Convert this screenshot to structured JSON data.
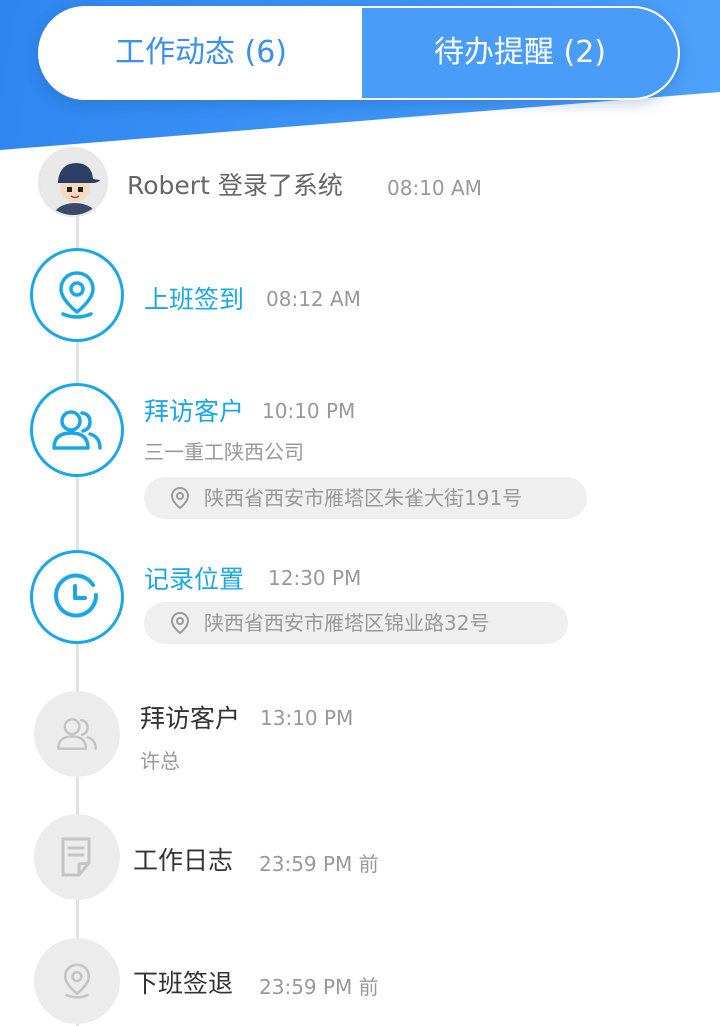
{
  "tabs": [
    {
      "label": "工作动态 (6)",
      "active": false
    },
    {
      "label": "待办提醒 (2)",
      "active": true
    }
  ],
  "timeline": {
    "login": {
      "user": "Robert",
      "action": "Robert 登录了系统",
      "time": "08:10 AM",
      "icon": "avatar"
    },
    "items": [
      {
        "title": "上班签到",
        "time": "08:12 AM",
        "icon": "location-pin-icon",
        "state": "active"
      },
      {
        "title": "拜访客户",
        "time": "10:10 PM",
        "subtitle": "三一重工陕西公司",
        "address": "陕西省西安市雁塔区朱雀大街191号",
        "icon": "users-icon",
        "state": "active"
      },
      {
        "title": "记录位置",
        "time": "12:30 PM",
        "address": "陕西省西安市雁塔区锦业路32号",
        "icon": "clock-icon",
        "state": "active"
      },
      {
        "title": "拜访客户",
        "time": "13:10 PM",
        "subtitle": "许总",
        "icon": "users-icon",
        "state": "pending"
      },
      {
        "title": "工作日志",
        "time": "23:59 PM 前",
        "icon": "document-icon",
        "state": "pending"
      },
      {
        "title": "下班签退",
        "time": "23:59 PM 前",
        "icon": "location-pin-icon",
        "state": "pending"
      }
    ]
  },
  "colors": {
    "accent": "#1aa7e8",
    "header_blue": "#3f95f7",
    "tab_active_bg": "#4a9cf9",
    "pending_node": "#ececec",
    "line": "#e2e2e2"
  }
}
